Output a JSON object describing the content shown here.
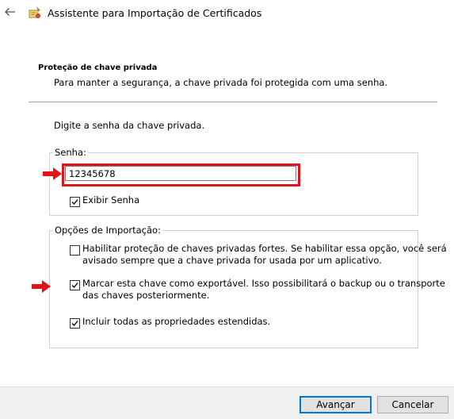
{
  "window": {
    "title": "Assistente para Importação de Certificados"
  },
  "icons": {
    "back": "back-arrow-icon",
    "wizard": "certificate-wizard-icon",
    "annotation": "red-arrow-icon"
  },
  "section": {
    "heading": "Proteção de chave privada",
    "description": "Para manter a segurança, a chave privada foi protegida com uma senha."
  },
  "instruction": "Digite a senha da chave privada.",
  "password_group": {
    "legend": "Senha:",
    "value": "12345678",
    "show_password": {
      "label": "Exibir Senha",
      "checked": true
    }
  },
  "options_group": {
    "legend": "Opções de Importação:",
    "options": [
      {
        "line1": "Habilitar proteção de chaves privadas fortes. Se habilitar essa opção, você será",
        "line2": "avisado sempre que a chave privada for usada por um aplicativo.",
        "checked": false
      },
      {
        "line1": "Marcar esta chave como exportável. Isso possibilitará o backup ou o transporte",
        "line2": "das chaves posteriormente.",
        "checked": true
      },
      {
        "line1": "Incluir todas as propriedades estendidas.",
        "line2": "",
        "checked": true
      }
    ]
  },
  "buttons": {
    "next": "Avançar",
    "cancel": "Cancelar"
  },
  "colors": {
    "highlight": "#e0141c",
    "primary_button_border": "#0078d7"
  }
}
